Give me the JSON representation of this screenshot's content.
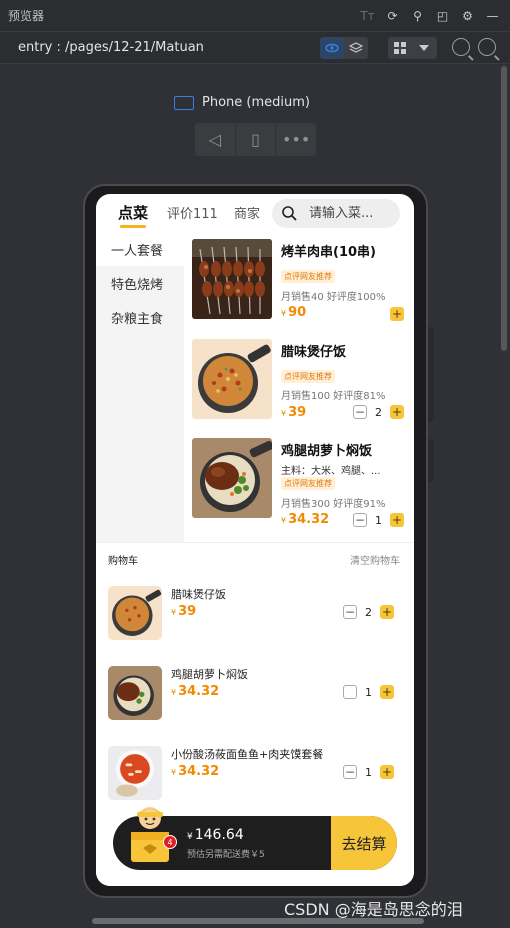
{
  "ide": {
    "title": "预览器",
    "path": "entry : /pages/12-21/Matuan",
    "device_name": "Phone (medium)"
  },
  "app": {
    "tabs": [
      {
        "label": "点菜"
      },
      {
        "label": "评价111"
      },
      {
        "label": "商家"
      }
    ],
    "search": {
      "placeholder": "请输入菜..."
    },
    "categories": [
      {
        "label": "一人套餐"
      },
      {
        "label": "特色烧烤"
      },
      {
        "label": "杂粮主食"
      }
    ],
    "dishes": [
      {
        "name": "烤羊肉串(10串)",
        "tag": "点评网友推荐",
        "stats": "月销售40 好评度100%",
        "currency": "¥",
        "price": "90"
      },
      {
        "name": "腊味煲仔饭",
        "tag": "点评网友推荐",
        "stats": "月销售100 好评度81%",
        "currency": "¥",
        "price": "39",
        "qty": "2"
      },
      {
        "name": "鸡腿胡萝卜焖饭",
        "desc": "主料：大米、鸡腿、...",
        "tag": "点评网友推荐",
        "stats": "月销售300 好评度91%",
        "currency": "¥",
        "price": "34.32",
        "qty": "1"
      }
    ],
    "cart": {
      "title": "购物车",
      "clear_label": "清空购物车",
      "items": [
        {
          "name": "腊味煲仔饭",
          "currency": "¥",
          "price": "39",
          "qty": "2"
        },
        {
          "name": "鸡腿胡萝卜焖饭",
          "currency": "¥",
          "price": "34.32",
          "qty": "1"
        },
        {
          "name": "小份酸汤莜面鱼鱼+肉夹馍套餐",
          "currency": "¥",
          "price": "34.32",
          "qty": "1"
        }
      ]
    },
    "checkout": {
      "badge_count": "4",
      "currency": "¥",
      "total": "146.64",
      "delivery_note": "预估另需配送费￥5",
      "button_label": "去结算"
    }
  },
  "watermark": "CSDN @海是岛思念的泪",
  "colors": {
    "accent": "#f7c53a",
    "price": "#f08a00",
    "ide_bg": "#2f3136",
    "select_blue": "#3c7de6"
  },
  "icons": [
    "translate-icon",
    "refresh-icon",
    "inspect-icon",
    "split-view-icon",
    "settings-icon",
    "minimize-icon",
    "layers-icon",
    "grid-icon",
    "chevron-down-icon",
    "zoom-out-icon",
    "zoom-in-icon",
    "rotate-icon",
    "fold-icon",
    "more-icon",
    "search-icon",
    "cart-icon"
  ]
}
